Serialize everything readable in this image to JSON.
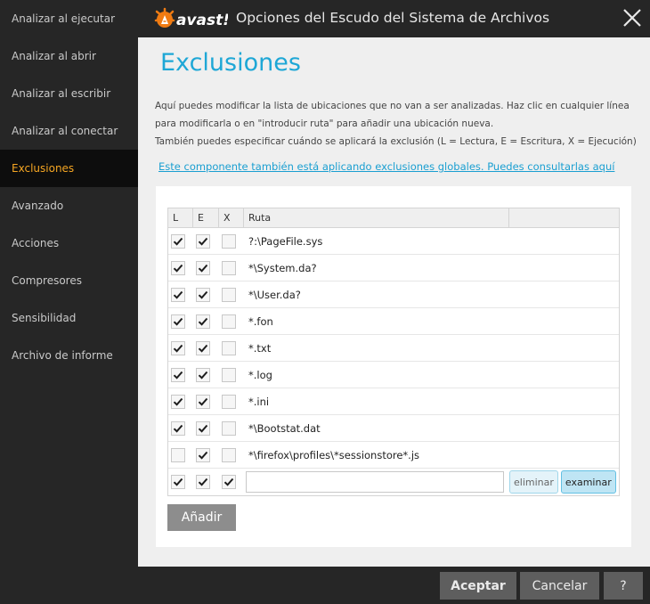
{
  "sidebar": {
    "items": [
      {
        "label": "Analizar al ejecutar"
      },
      {
        "label": "Analizar al abrir"
      },
      {
        "label": "Analizar al escribir"
      },
      {
        "label": "Analizar al conectar"
      },
      {
        "label": "Exclusiones",
        "active": true
      },
      {
        "label": "Avanzado"
      },
      {
        "label": "Acciones"
      },
      {
        "label": "Compresores"
      },
      {
        "label": "Sensibilidad"
      },
      {
        "label": "Archivo de informe"
      }
    ]
  },
  "window": {
    "title": "Opciones del Escudo del Sistema de Archivos",
    "brand_text": "avast!",
    "brand_color": "#f07b12"
  },
  "main": {
    "heading": "Exclusiones",
    "description": [
      "Aquí puedes modificar la lista de ubicaciones que no van a ser analizadas. Haz clic en cualquier línea",
      "para modificarla o en \"introducir ruta\" para añadir una ubicación nueva.",
      "También puedes especificar cuándo se aplicará la exclusión (L = Lectura, E = Escritura, X = Ejecución)"
    ],
    "global_link": "Este componente también está aplicando exclusiones globales. Puedes consultarlas aquí"
  },
  "table": {
    "headers": {
      "l": "L",
      "e": "E",
      "x": "X",
      "ruta": "Ruta"
    },
    "rows": [
      {
        "l": true,
        "e": true,
        "x": false,
        "path": "?:\\PageFile.sys"
      },
      {
        "l": true,
        "e": true,
        "x": false,
        "path": "*\\System.da?"
      },
      {
        "l": true,
        "e": true,
        "x": false,
        "path": "*\\User.da?"
      },
      {
        "l": true,
        "e": true,
        "x": false,
        "path": "*.fon"
      },
      {
        "l": true,
        "e": true,
        "x": false,
        "path": "*.txt"
      },
      {
        "l": true,
        "e": true,
        "x": false,
        "path": "*.log"
      },
      {
        "l": true,
        "e": true,
        "x": false,
        "path": "*.ini"
      },
      {
        "l": true,
        "e": true,
        "x": false,
        "path": "*\\Bootstat.dat"
      },
      {
        "l": false,
        "e": true,
        "x": false,
        "path": "*\\firefox\\profiles\\*sessionstore*.js"
      }
    ],
    "edit_row": {
      "l": true,
      "e": true,
      "x": true,
      "value": "",
      "delete_label": "eliminar",
      "browse_label": "examinar"
    }
  },
  "add_button": "Añadir",
  "footer": {
    "accept": "Aceptar",
    "cancel": "Cancelar",
    "help": "?"
  },
  "colors": {
    "accent": "#1ea7d6",
    "active_sidebar": "#f5a623",
    "sidebar_bg": "#262626"
  }
}
